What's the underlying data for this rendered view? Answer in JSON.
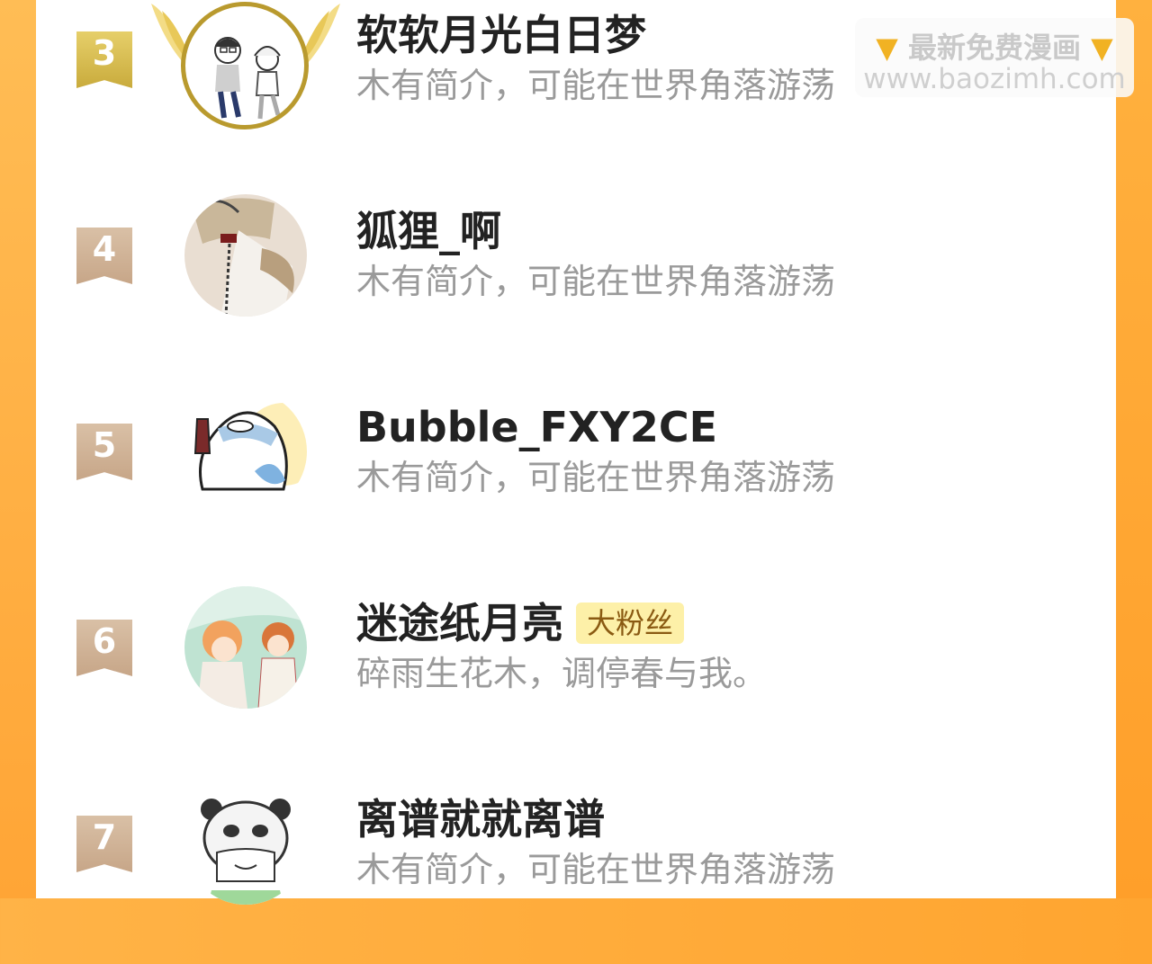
{
  "watermark": {
    "title": "最新免费漫画",
    "left_icon": "pointing-down-hand-icon",
    "right_icon": "pointing-down-hand-icon",
    "url": "www.baozimh.com"
  },
  "colors": {
    "frame_orange": "#ffa530",
    "rank_gold": "#d4b44a",
    "rank_bronze": "#cfb196",
    "badge_bg": "#fdf0a8"
  },
  "fans": [
    {
      "rank": "3",
      "name": "软软月光白日梦",
      "bio": "木有简介，可能在世界角落游荡",
      "badge": ""
    },
    {
      "rank": "4",
      "name": "狐狸_啊",
      "bio": "木有简介，可能在世界角落游荡",
      "badge": ""
    },
    {
      "rank": "5",
      "name": "Bubble_FXY2CE",
      "bio": "木有简介，可能在世界角落游荡",
      "badge": ""
    },
    {
      "rank": "6",
      "name": "迷途纸月亮",
      "bio": "碎雨生花木，调停春与我。",
      "badge": "大粉丝"
    },
    {
      "rank": "7",
      "name": "离谱就就离谱",
      "bio": "木有简介，可能在世界角落游荡",
      "badge": ""
    }
  ]
}
